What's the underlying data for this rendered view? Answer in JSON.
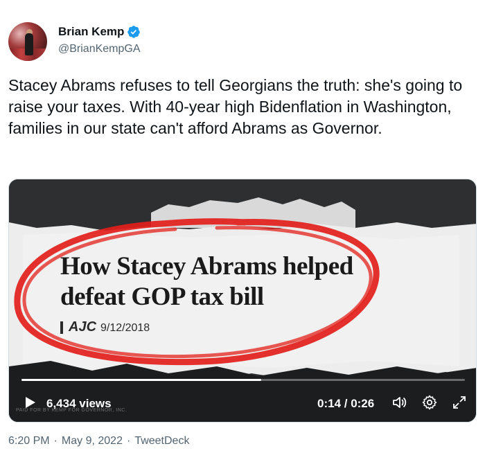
{
  "author": {
    "name": "Brian Kemp",
    "handle": "@BrianKempGA",
    "verified": true,
    "avatar_icon": "profile-photo"
  },
  "tweet": {
    "text": "Stacey Abrams refuses to tell Georgians the truth: she's going to raise your taxes. With 40-year high Bidenflation in Washington, families in our state can't afford Abrams as Governor."
  },
  "video": {
    "headline_line1": "How Stacey Abrams helped",
    "headline_line2": "defeat GOP tax bill",
    "source_name": "AJC",
    "source_date": "9/12/2018",
    "views": "6,434 views",
    "time": "0:14 / 0:26",
    "progress_fraction": 0.54,
    "watermark": "PAID FOR BY KEMP FOR GOVERNOR, INC.",
    "circle_color": "#e3201b",
    "icons": [
      "play-icon",
      "volume-icon",
      "settings-icon",
      "fullscreen-icon"
    ]
  },
  "footer": {
    "time": "6:20 PM",
    "date": "May 9, 2022",
    "client": "TweetDeck",
    "separator": "·"
  },
  "colors": {
    "verified_blue": "#1d9bf0",
    "secondary_text": "#536471"
  }
}
